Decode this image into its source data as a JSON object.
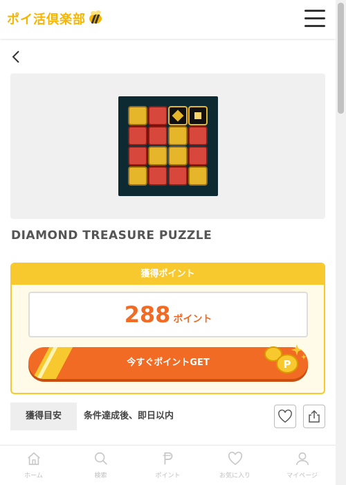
{
  "header": {
    "logo_text": "ポイ活倶楽部",
    "logo_icon": "bee-icon",
    "menu_icon": "hamburger-menu-icon"
  },
  "navigation": {
    "back_icon": "chevron-left-icon"
  },
  "offer": {
    "title": "DIAMOND TREASURE PUZZLE",
    "image_icon": "game-thumbnail"
  },
  "points_card": {
    "heading": "獲得ポイント",
    "points": "288",
    "unit": "ポイント",
    "cta_label": "今すぐポイントGET"
  },
  "meta": {
    "tag": "獲得目安",
    "text": "条件達成後、即日以内",
    "favorite_icon": "heart-icon",
    "share_icon": "share-icon"
  },
  "bottom_nav": [
    {
      "label": "ホーム",
      "icon": "home-icon"
    },
    {
      "label": "検索",
      "icon": "search-icon"
    },
    {
      "label": "ポイント",
      "icon": "p-point-icon"
    },
    {
      "label": "お気に入り",
      "icon": "heart-icon"
    },
    {
      "label": "マイページ",
      "icon": "user-icon"
    }
  ],
  "colors": {
    "brand_yellow": "#f8c82f",
    "accent_orange": "#f26b24",
    "logo_yellow": "#f7b500"
  }
}
